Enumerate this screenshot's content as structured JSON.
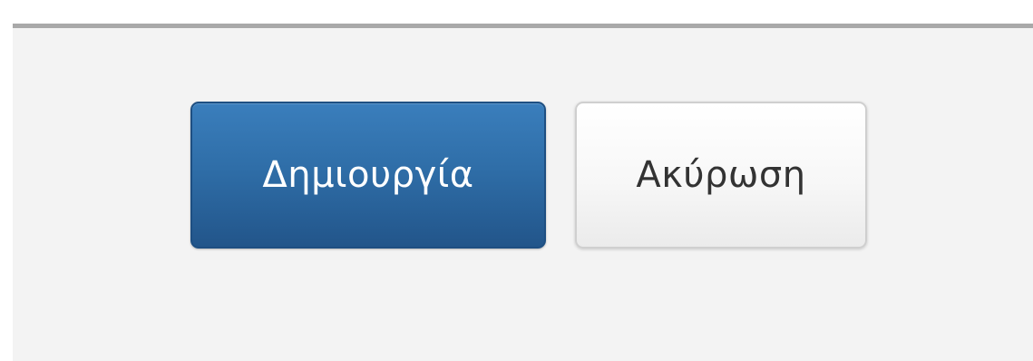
{
  "footer": {
    "create_label": "Δημιουργία",
    "cancel_label": "Ακύρωση"
  },
  "colors": {
    "primary": "#2f6ea8",
    "primary_border": "#1e4f82",
    "default_bg": "#f7f7f7",
    "panel_bg": "#f3f3f3",
    "separator": "#a9a9a9"
  }
}
